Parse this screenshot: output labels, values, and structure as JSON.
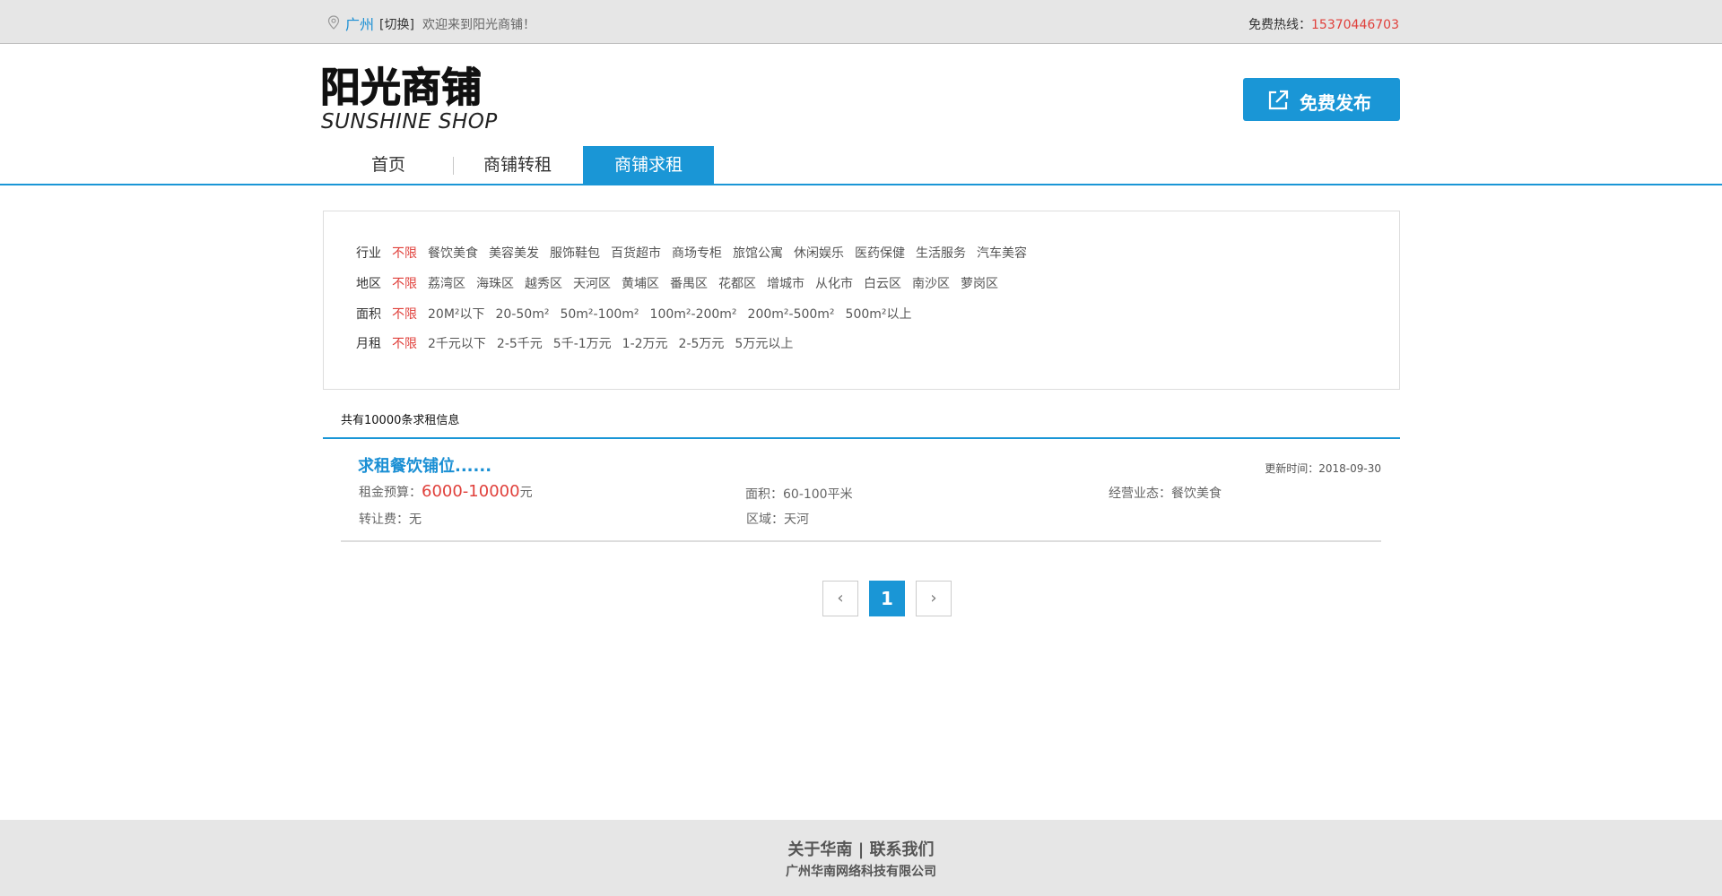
{
  "topbar": {
    "city": "广州",
    "switch_label": "[切换]",
    "welcome": "欢迎来到阳光商铺！",
    "hotline_label": "免费热线：",
    "hotline_number": "15370446703"
  },
  "header": {
    "logo_cn": "阳光商铺",
    "logo_en": "SUNSHINE SHOP",
    "publish_label": "免费发布"
  },
  "nav": {
    "items": [
      {
        "label": "首页"
      },
      {
        "label": "商铺转租"
      },
      {
        "label": "商铺求租"
      }
    ],
    "active_index": 2
  },
  "filters": {
    "industry": {
      "label": "行业",
      "options": [
        "不限",
        "餐饮美食",
        "美容美发",
        "服饰鞋包",
        "百货超市",
        "商场专柜",
        "旅馆公寓",
        "休闲娱乐",
        "医药保健",
        "生活服务",
        "汽车美容"
      ]
    },
    "district": {
      "label": "地区",
      "options": [
        "不限",
        "荔湾区",
        "海珠区",
        "越秀区",
        "天河区",
        "黄埔区",
        "番禺区",
        "花都区",
        "增城市",
        "从化市",
        "白云区",
        "南沙区",
        "萝岗区"
      ]
    },
    "area": {
      "label": "面积",
      "options": [
        "不限",
        "20M²以下",
        "20-50m²",
        "50m²-100m²",
        "100m²-200m²",
        "200m²-500m²",
        "500m²以上"
      ]
    },
    "rent": {
      "label": "月租",
      "options": [
        "不限",
        "2千元以下",
        "2-5千元",
        "5千-1万元",
        "1-2万元",
        "2-5万元",
        "5万元以上"
      ]
    }
  },
  "results": {
    "count_text": "共有10000条求租信息"
  },
  "listing": {
    "title": "求租餐饮铺位......",
    "updated": "更新时间：2018-09-30",
    "budget_label": "租金预算：",
    "budget_value": "6000-10000",
    "budget_unit": "元",
    "area": "面积：60-100平米",
    "business": "经营业态：餐饮美食",
    "transfer_fee": "转让费：无",
    "district": "区域：天河"
  },
  "pagination": {
    "prev_icon": "‹",
    "current": "1",
    "next_icon": "›"
  },
  "footer": {
    "about": "关于华南",
    "separator": "|",
    "contact": "联系我们",
    "company": "广州华南网络科技有限公司"
  },
  "colors": {
    "accent": "#1a96d6",
    "highlight": "#e0403b",
    "bar_bg": "#e6e6e6"
  }
}
